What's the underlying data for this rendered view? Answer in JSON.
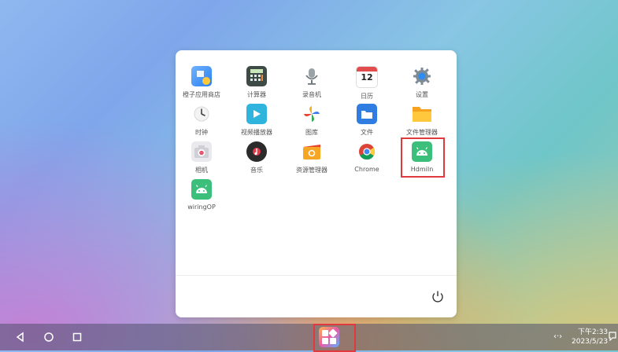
{
  "drawer": {
    "apps": [
      {
        "label": "橙子应用商店",
        "icon": "store-icon"
      },
      {
        "label": "计算器",
        "icon": "calculator-icon"
      },
      {
        "label": "录音机",
        "icon": "microphone-icon"
      },
      {
        "label": "日历",
        "icon": "calendar-icon",
        "date": "12"
      },
      {
        "label": "设置",
        "icon": "gear-icon"
      },
      {
        "label": "时钟",
        "icon": "clock-icon"
      },
      {
        "label": "视频播放器",
        "icon": "play-icon"
      },
      {
        "label": "图库",
        "icon": "pinwheel-icon"
      },
      {
        "label": "文件",
        "icon": "folder-icon"
      },
      {
        "label": "文件管理器",
        "icon": "folder-icon"
      },
      {
        "label": "相机",
        "icon": "camera-icon"
      },
      {
        "label": "音乐",
        "icon": "music-icon"
      },
      {
        "label": "资源管理器",
        "icon": "wallet-icon"
      },
      {
        "label": "Chrome",
        "icon": "chrome-icon"
      },
      {
        "label": "HdmiIn",
        "icon": "android-icon"
      },
      {
        "label": "wiringOP",
        "icon": "android-icon"
      }
    ]
  },
  "taskbar": {
    "time": "下午2:33",
    "date": "2023/5/23",
    "icons": [
      "back-icon",
      "home-icon",
      "recents-icon",
      "app-launcher-icon",
      "network-icon",
      "notification-icon"
    ]
  },
  "colors": {
    "highlight": "#e0393e",
    "android": "#3bbf7a"
  }
}
